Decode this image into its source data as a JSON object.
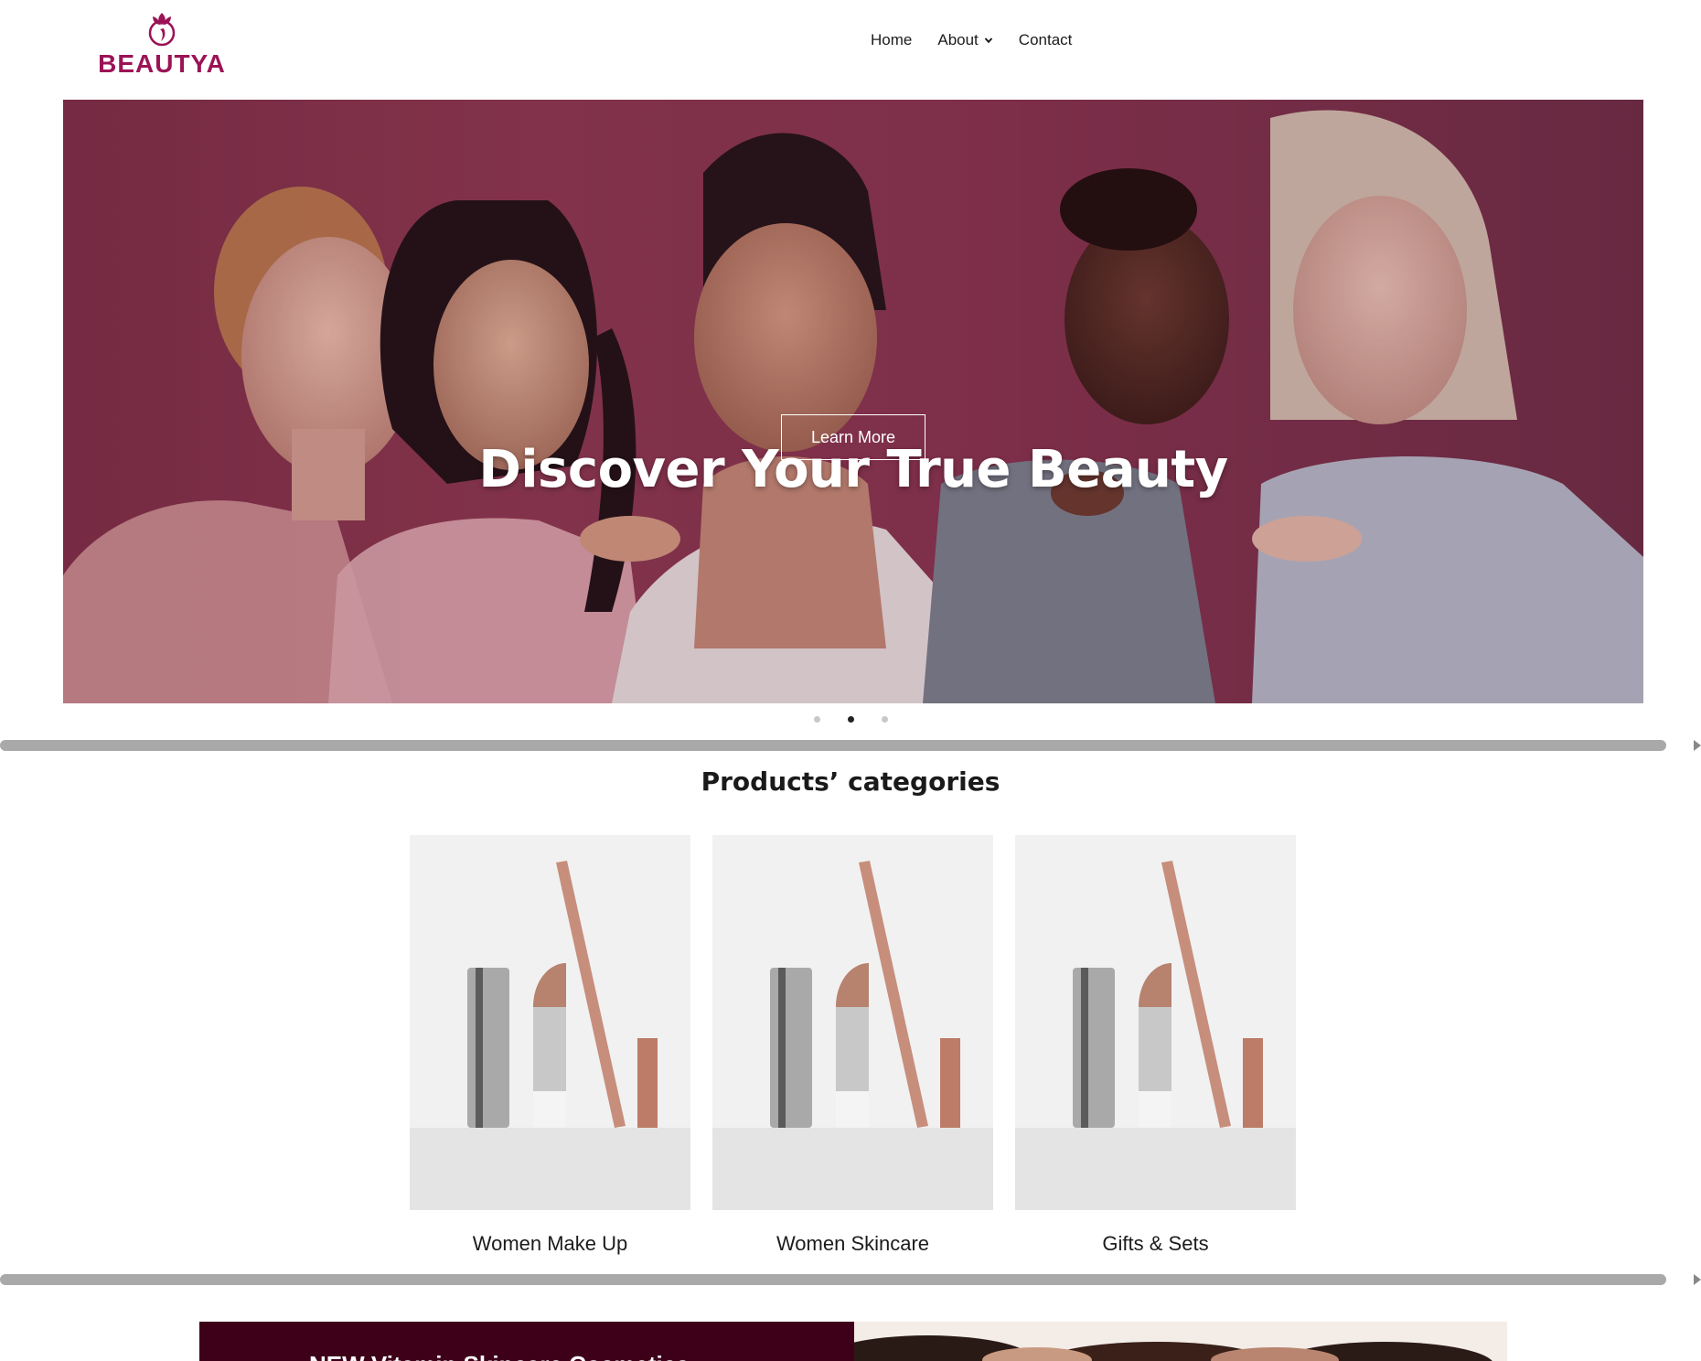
{
  "brand": {
    "name": "BEAUTYA",
    "color": "#9b1356"
  },
  "nav": {
    "items": [
      {
        "label": "Home"
      },
      {
        "label": "About"
      },
      {
        "label": "Contact"
      }
    ]
  },
  "hero": {
    "title": "Discover Your True Beauty",
    "button_label": "Learn More",
    "slides_total": 3,
    "active_slide": 2
  },
  "categories": {
    "title": "Products’ categories",
    "items": [
      {
        "label": "Women Make Up"
      },
      {
        "label": "Women Skincare"
      },
      {
        "label": "Gifts & Sets"
      }
    ]
  },
  "promo": {
    "text": "NEW Vitamin Skincare Cosmetics"
  },
  "colors": {
    "accent": "#9b1356",
    "promo_dark": "#3d0018",
    "scrollbar": "#a9a9a9"
  }
}
